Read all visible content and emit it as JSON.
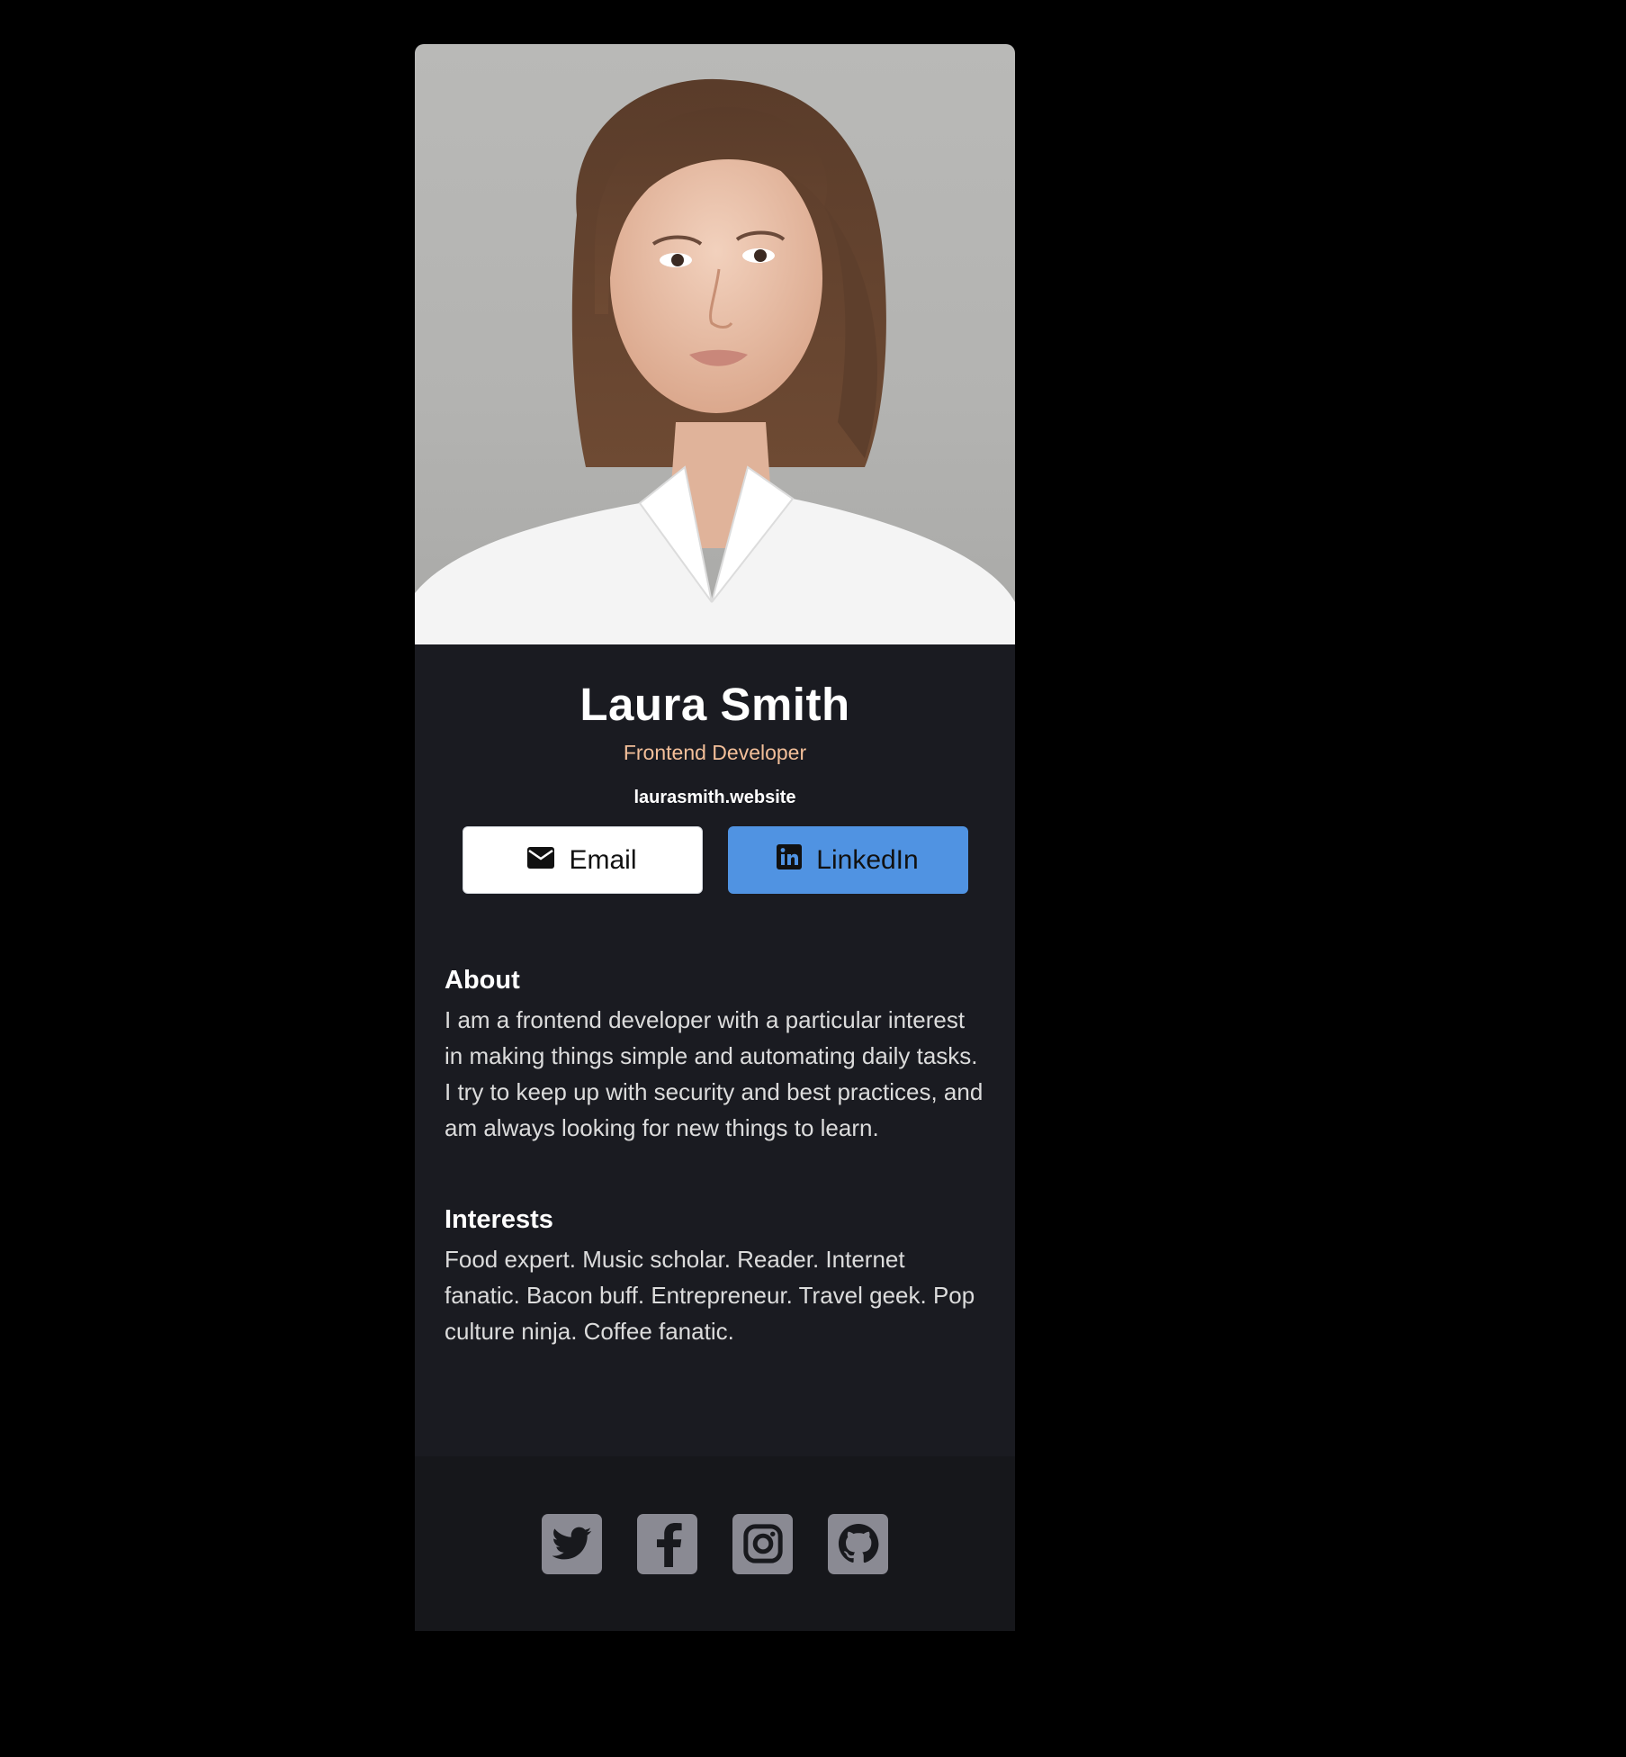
{
  "profile": {
    "name": "Laura Smith",
    "role": "Frontend Developer",
    "website": "laurasmith.website"
  },
  "buttons": {
    "email_label": "Email",
    "linkedin_label": "LinkedIn"
  },
  "about": {
    "heading": "About",
    "text": "I am a frontend developer with a particular interest in making things simple and automating daily tasks. I try to keep up with security and best practices, and am always looking for new things to learn."
  },
  "interests": {
    "heading": "Interests",
    "text": "Food expert. Music scholar. Reader. Internet fanatic. Bacon buff. Entrepreneur. Travel geek. Pop culture ninja. Coffee fanatic."
  },
  "social": [
    {
      "icon": "twitter-icon"
    },
    {
      "icon": "facebook-icon"
    },
    {
      "icon": "instagram-icon"
    },
    {
      "icon": "github-icon"
    }
  ],
  "colors": {
    "page_background": "#000000",
    "card_background": "#1a1b21",
    "footer_background": "#16171b",
    "role_accent": "#f3bf99",
    "linkedin_button": "#5093e2",
    "email_button": "#ffffff",
    "social_icon_bg": "#8a8a93"
  }
}
